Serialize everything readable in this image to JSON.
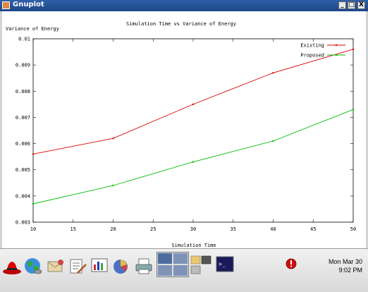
{
  "window": {
    "title": "Gnuplot",
    "buttons": [
      "_",
      "□",
      "X"
    ]
  },
  "chart_data": {
    "type": "line",
    "title": "Simulation Time vs Variance of Energy",
    "xlabel": "Simulation Time",
    "ylabel": "Variance of Energy",
    "xlim": [
      10,
      50
    ],
    "ylim": [
      0.003,
      0.01
    ],
    "x_ticks": [
      "10",
      "15",
      "20",
      "25",
      "30",
      "35",
      "40",
      "45",
      "50"
    ],
    "y_ticks": [
      "0.01",
      "0.009",
      "0.008",
      "0.007",
      "0.006",
      "0.005",
      "0.004",
      "0.003"
    ],
    "legend_position": "top-right",
    "grid": false,
    "series": [
      {
        "name": "Existing",
        "color": "#dd0000",
        "x": [
          10,
          20,
          30,
          40,
          50
        ],
        "values": [
          0.0056,
          0.0062,
          0.0075,
          0.0087,
          0.0096
        ]
      },
      {
        "name": "Proposed",
        "color": "#00bb00",
        "x": [
          10,
          20,
          30,
          40,
          50
        ],
        "values": [
          0.0037,
          0.0044,
          0.0053,
          0.0061,
          0.0073
        ]
      }
    ]
  },
  "taskbar": {
    "icons": [
      "redhat-icon",
      "web-browser-icon",
      "email-icon",
      "text-editor-icon",
      "presentation-icon",
      "spreadsheet-icon",
      "printer-icon",
      "workspace-switcher-icon",
      "file-manager-icon",
      "terminal-icon",
      "alert-icon"
    ],
    "clock_date": "Mon Mar 30",
    "clock_time": "9:02 PM"
  }
}
